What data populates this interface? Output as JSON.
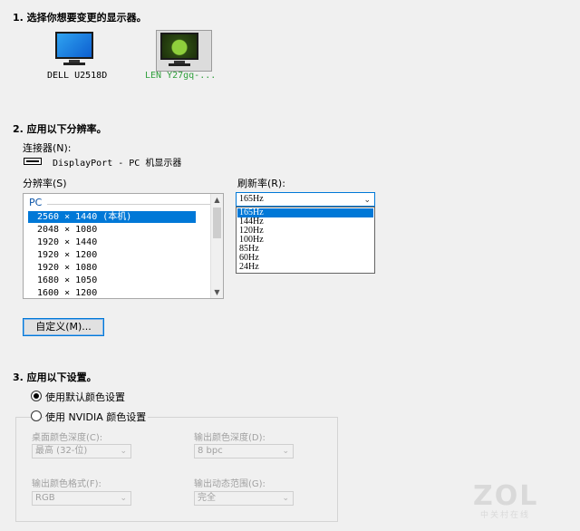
{
  "step1": {
    "heading": "1. 选择你想要变更的显示器。"
  },
  "monitors": [
    {
      "label": "DELL U2518D",
      "selected": false
    },
    {
      "label": "LEN Y27gq-...",
      "selected": true
    }
  ],
  "step2": {
    "heading": "2. 应用以下分辨率。",
    "connector_label": "连接器(N):",
    "connector_value": "DisplayPort - PC 机显示器",
    "connector_icon": "displayport-icon",
    "resolution_label": "分辨率(S)",
    "refresh_label": "刷新率(R):",
    "resolution_group": "PC",
    "resolutions": [
      "2560 × 1440 (本机)",
      "2048 × 1080",
      "1920 × 1440",
      "1920 × 1200",
      "1920 × 1080",
      "1680 × 1050",
      "1600 × 1200"
    ],
    "selected_resolution": "2560 × 1440 (本机)",
    "refresh_current": "165Hz",
    "refresh_options": [
      "165Hz",
      "144Hz",
      "120Hz",
      "100Hz",
      "85Hz",
      "60Hz",
      "24Hz"
    ],
    "custom_button": "自定义(M)..."
  },
  "step3": {
    "heading": "3. 应用以下设置。",
    "radio_default": "使用默认颜色设置",
    "radio_nvidia": "使用 NVIDIA 颜色设置",
    "default_checked": true,
    "desktop_depth_label": "桌面颜色深度(C):",
    "desktop_depth_value": "最高 (32-位)",
    "output_depth_label": "输出颜色深度(D):",
    "output_depth_value": "8 bpc",
    "output_format_label": "输出颜色格式(F):",
    "output_format_value": "RGB",
    "dynamic_range_label": "输出动态范围(G):",
    "dynamic_range_value": "完全"
  },
  "watermark": {
    "logo": "ZOL",
    "sub": "中关村在线"
  },
  "colors": {
    "accent": "#0078d7",
    "group_label": "#0a53a7",
    "disabled": "#a0a0a0"
  }
}
